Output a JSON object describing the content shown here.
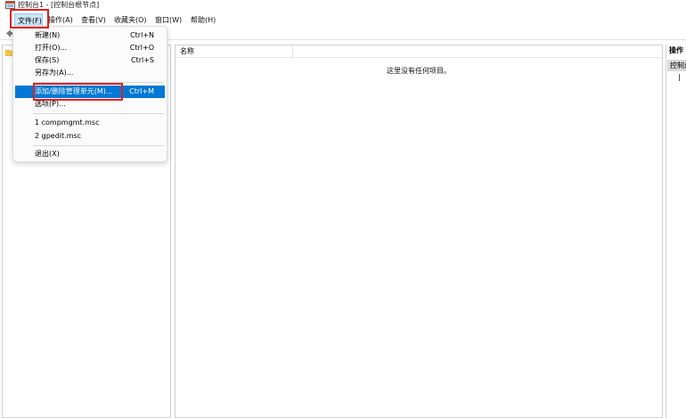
{
  "window": {
    "title": "控制台1 - [控制台根节点]"
  },
  "menubar": {
    "items": [
      "文件(F)",
      "操作(A)",
      "查看(V)",
      "收藏夹(O)",
      "窗口(W)",
      "帮助(H)"
    ]
  },
  "file_menu": {
    "items": [
      {
        "label": "新建(N)",
        "shortcut": "Ctrl+N"
      },
      {
        "label": "打开(O)...",
        "shortcut": "Ctrl+O"
      },
      {
        "label": "保存(S)",
        "shortcut": "Ctrl+S"
      },
      {
        "label": "另存为(A)...",
        "shortcut": ""
      },
      {
        "label": "添加/删除管理单元(M)...",
        "shortcut": "Ctrl+M"
      },
      {
        "label": "选项(P)...",
        "shortcut": ""
      },
      {
        "label": "1 compmgmt.msc",
        "shortcut": ""
      },
      {
        "label": "2 gpedit.msc",
        "shortcut": ""
      },
      {
        "label": "退出(X)",
        "shortcut": ""
      }
    ]
  },
  "center_pane": {
    "column_name": "名称",
    "empty_message": "这里没有任何项目。"
  },
  "actions_pane": {
    "header": "操作",
    "selected_item": "控制台根节点"
  },
  "icons": [
    "mmc-app-icon",
    "back-arrow-icon",
    "folder-icon"
  ],
  "colors": {
    "highlight": "#0078d4",
    "annotation_box": "#e02020",
    "menu_hover": "#cce4f7"
  }
}
